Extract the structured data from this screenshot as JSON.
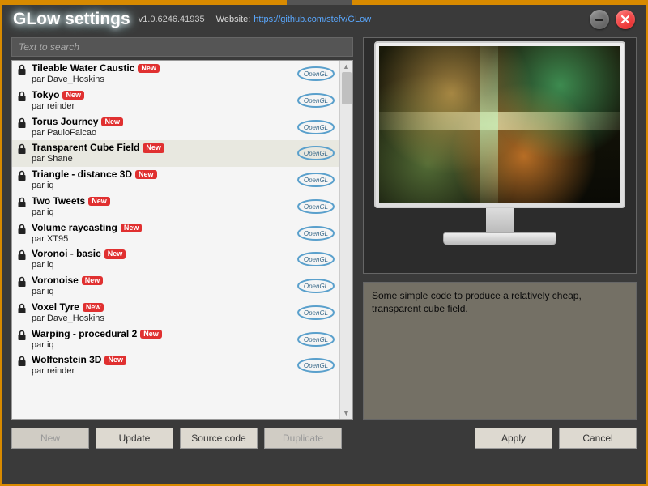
{
  "header": {
    "title": "GLow settings",
    "version": "v1.0.6246.41935",
    "website_label": "Website:",
    "website_url": "https://github.com/stefv/GLow"
  },
  "search": {
    "placeholder": "Text to search"
  },
  "list": {
    "author_prefix": "par",
    "new_label": "New",
    "opengl_label": "OpenGL",
    "items": [
      {
        "title": "Tileable Water Caustic",
        "author": "Dave_Hoskins",
        "new": true,
        "selected": false
      },
      {
        "title": "Tokyo",
        "author": "reinder",
        "new": true,
        "selected": false
      },
      {
        "title": "Torus Journey",
        "author": "PauloFalcao",
        "new": true,
        "selected": false
      },
      {
        "title": "Transparent Cube Field",
        "author": "Shane",
        "new": true,
        "selected": true
      },
      {
        "title": "Triangle - distance 3D",
        "author": "iq",
        "new": true,
        "selected": false
      },
      {
        "title": "Two Tweets",
        "author": "iq",
        "new": true,
        "selected": false
      },
      {
        "title": "Volume raycasting",
        "author": "XT95",
        "new": true,
        "selected": false
      },
      {
        "title": "Voronoi - basic",
        "author": "iq",
        "new": true,
        "selected": false
      },
      {
        "title": "Voronoise",
        "author": "iq",
        "new": true,
        "selected": false
      },
      {
        "title": "Voxel Tyre",
        "author": "Dave_Hoskins",
        "new": true,
        "selected": false
      },
      {
        "title": "Warping - procedural 2",
        "author": "iq",
        "new": true,
        "selected": false
      },
      {
        "title": "Wolfenstein 3D",
        "author": "reinder",
        "new": true,
        "selected": false
      }
    ]
  },
  "description": "Some simple code to produce a relatively cheap, transparent cube field.",
  "buttons": {
    "new": "New",
    "update": "Update",
    "source": "Source code",
    "duplicate": "Duplicate",
    "apply": "Apply",
    "cancel": "Cancel"
  }
}
